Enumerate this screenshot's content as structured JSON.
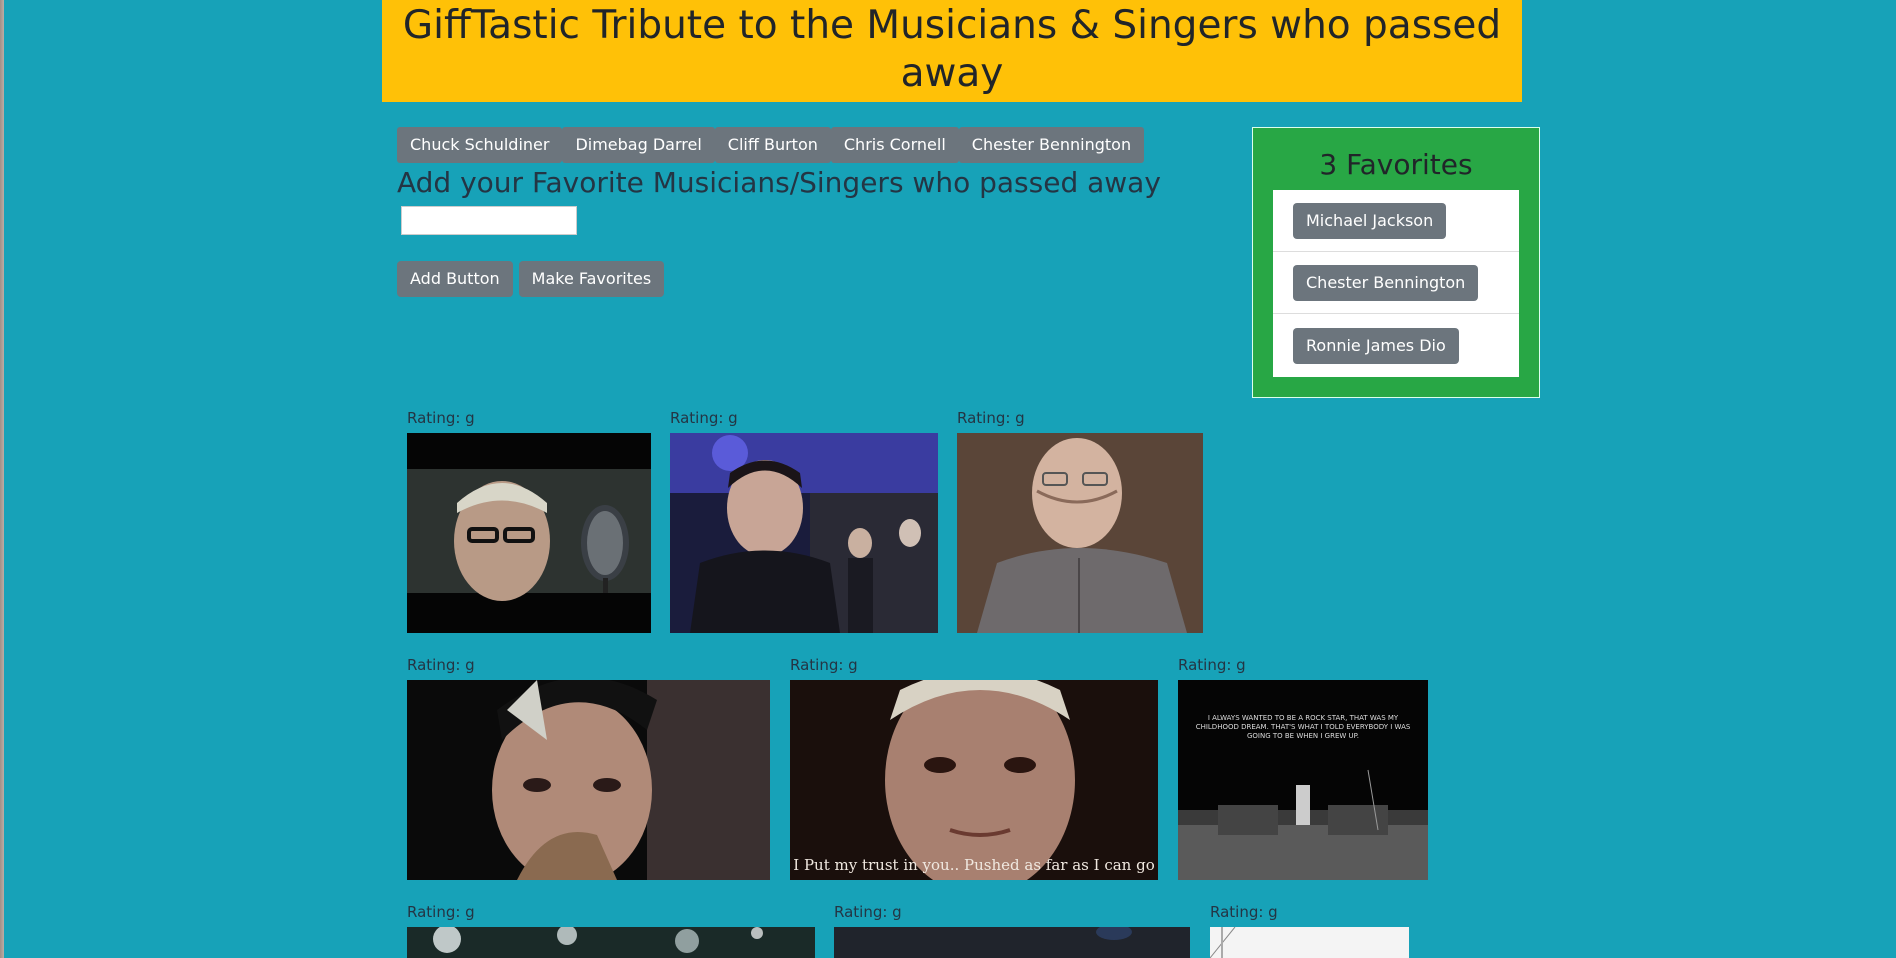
{
  "page": {
    "title": "GiffTastic Tribute to the Musicians & Singers who passed away"
  },
  "musician_buttons": [
    "Chuck Schuldiner",
    "Dimebag Darrel",
    "Cliff Burton",
    "Chris Cornell",
    "Chester Bennington"
  ],
  "add_section": {
    "heading": "Add your Favorite Musicians/Singers who passed away",
    "input_value": "",
    "add_button": "Add Button",
    "favorites_button": "Make Favorites"
  },
  "favorites": {
    "title": "3 Favorites",
    "items": [
      "Michael Jackson",
      "Chester Bennington",
      "Ronnie James Dio"
    ]
  },
  "gifs": [
    {
      "rating": "Rating: g",
      "caption": ""
    },
    {
      "rating": "Rating: g",
      "caption": ""
    },
    {
      "rating": "Rating: g",
      "caption": ""
    },
    {
      "rating": "Rating: g",
      "caption": ""
    },
    {
      "rating": "Rating: g",
      "caption": "I Put my trust in you.. Pushed as far as I can go"
    },
    {
      "rating": "Rating: g",
      "caption": "I always wanted to be a rock star, that was my childhood dream. That's what I told everybody I was going to be when I grew up."
    },
    {
      "rating": "Rating: g",
      "caption": ""
    },
    {
      "rating": "Rating: g",
      "caption": ""
    },
    {
      "rating": "Rating: g",
      "caption": ""
    }
  ]
}
